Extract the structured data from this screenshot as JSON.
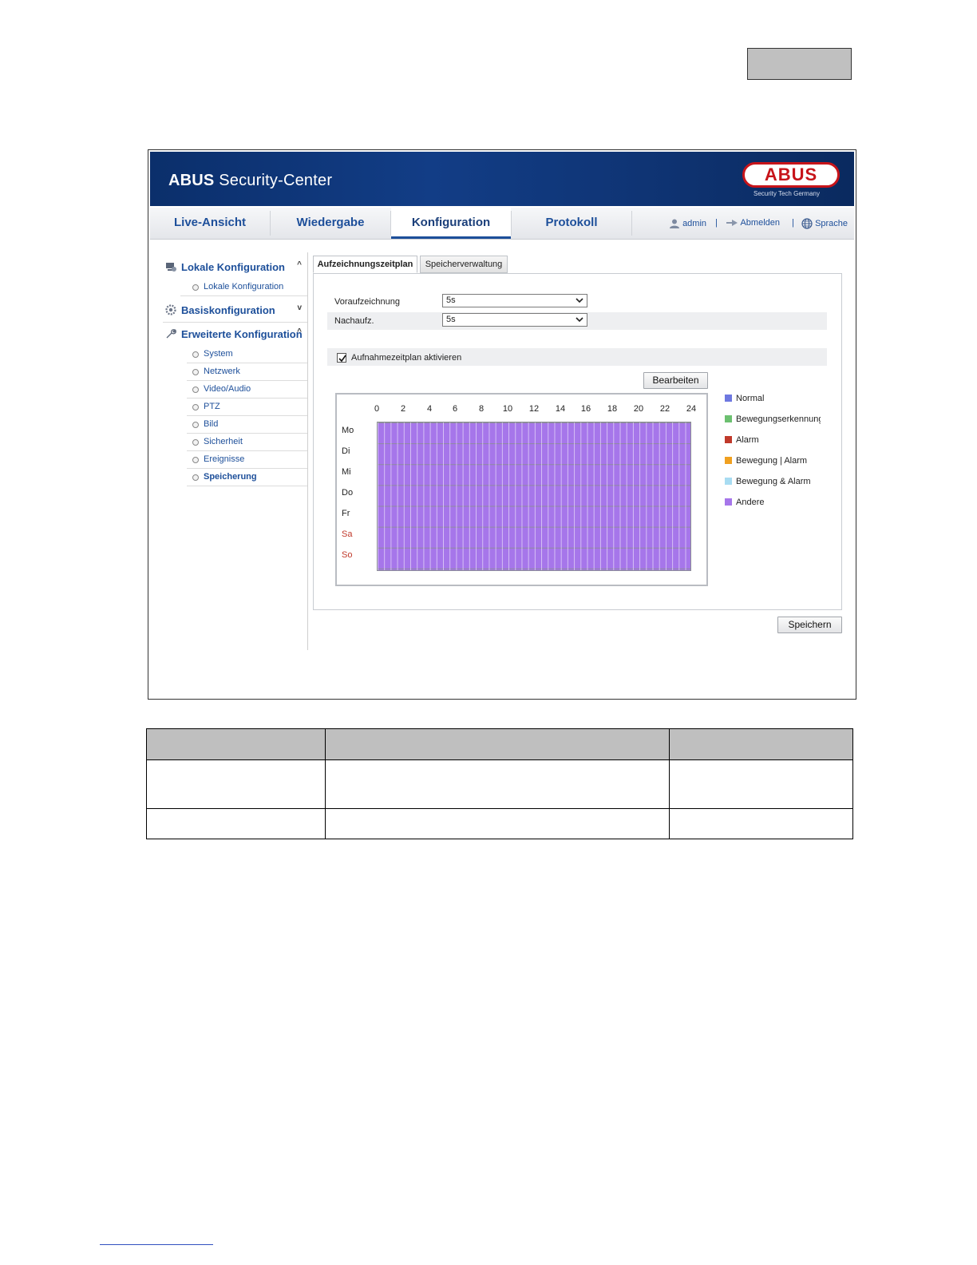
{
  "header": {
    "brand_bold": "ABUS",
    "brand_rest": " Security-Center",
    "logo_text": "ABUS",
    "logo_tagline": "Security Tech Germany"
  },
  "nav": {
    "tabs": [
      {
        "label": "Live-Ansicht"
      },
      {
        "label": "Wiedergabe"
      },
      {
        "label": "Konfiguration"
      },
      {
        "label": "Protokoll"
      }
    ],
    "active_tab": "Konfiguration",
    "user": "admin",
    "logout": "Abmelden",
    "language": "Sprache",
    "separator": "|"
  },
  "sidebar": {
    "groups": [
      {
        "label": "Lokale Konfiguration",
        "chevron": "^",
        "items": [
          "Lokale Konfiguration"
        ]
      },
      {
        "label": "Basiskonfiguration",
        "chevron": "v",
        "items": []
      },
      {
        "label": "Erweiterte Konfiguration",
        "chevron": "^",
        "items": [
          "System",
          "Netzwerk",
          "Video/Audio",
          "PTZ",
          "Bild",
          "Sicherheit",
          "Ereignisse",
          "Speicherung"
        ]
      }
    ],
    "active_item": "Speicherung"
  },
  "content": {
    "tabs": [
      "Aufzeichnungszeitplan",
      "Speicherverwaltung"
    ],
    "active_tab": "Aufzeichnungszeitplan",
    "pre_record_label": "Voraufzeichnung",
    "pre_record_value": "5s",
    "post_record_label": "Nachaufz.",
    "post_record_value": "5s",
    "enable_schedule_label": "Aufnahmezeitplan aktivieren",
    "enable_schedule_checked": true,
    "edit_button": "Bearbeiten",
    "save_button": "Speichern"
  },
  "schedule": {
    "hours": [
      "0",
      "2",
      "4",
      "6",
      "8",
      "10",
      "12",
      "14",
      "16",
      "18",
      "20",
      "22",
      "24"
    ],
    "days": [
      "Mo",
      "Di",
      "Mi",
      "Do",
      "Fr",
      "Sa",
      "So"
    ],
    "weekend_color": "#c0392b",
    "fill_color": "#a676ea",
    "fill_type": "Andere"
  },
  "legend": [
    {
      "label": "Normal",
      "color": "#6e78e0"
    },
    {
      "label": "Bewegungserkennung",
      "color": "#6cc070"
    },
    {
      "label": "Alarm",
      "color": "#c0392b"
    },
    {
      "label": "Bewegung | Alarm",
      "color": "#f0a020"
    },
    {
      "label": "Bewegung & Alarm",
      "color": "#a8dcf2"
    },
    {
      "label": "Andere",
      "color": "#a676ea"
    }
  ]
}
